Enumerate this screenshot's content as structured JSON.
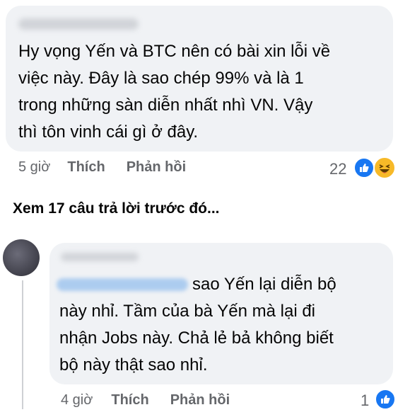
{
  "comment1": {
    "text_lines": [
      "Hy vọng Yến và BTC nên có bài xin lỗi về",
      "việc này. Đây là sao chép 99% và là 1",
      "trong những sàn diễn nhất nhì VN. Vậy",
      "thì tôn vinh cái gì ở đây."
    ],
    "time": "5 giờ",
    "like_label": "Thích",
    "reply_label": "Phản hồi",
    "reaction_count": "22",
    "reaction_icons": [
      "like-icon",
      "haha-icon"
    ]
  },
  "view_more": "Xem 17 câu trả lời trước đó...",
  "comment2": {
    "text_lines": [
      "sao Yến lại diễn bộ",
      "này nhỉ. Tầm của bà Yến mà lại đi",
      "nhận Jobs này. Chả lẻ bả không biết",
      "bộ này thật sao nhỉ."
    ],
    "time": "4 giờ",
    "like_label": "Thích",
    "reply_label": "Phản hồi",
    "reaction_count": "1",
    "reaction_icons": [
      "like-icon"
    ]
  },
  "colors": {
    "bubble": "#f0f2f5",
    "meta_text": "#65676b",
    "like_blue": "#1877f2",
    "haha_yellow": "#f7b928"
  }
}
